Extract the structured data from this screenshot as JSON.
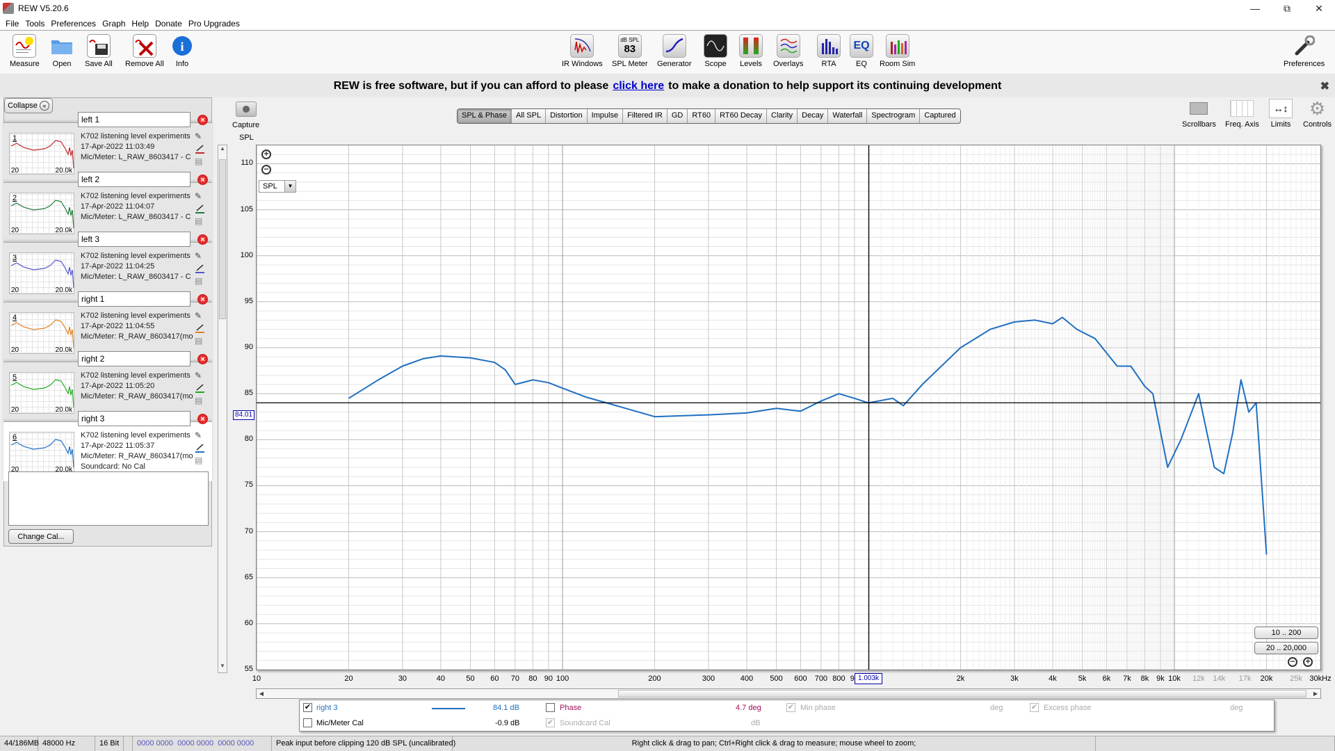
{
  "window": {
    "title": "REW V5.20.6",
    "controls": [
      "minimize",
      "restore",
      "close"
    ]
  },
  "menu": [
    "File",
    "Tools",
    "Preferences",
    "Graph",
    "Help",
    "Donate",
    "Pro Upgrades"
  ],
  "toolbar": {
    "left": [
      {
        "label": "Measure",
        "icon": "measure-icon"
      },
      {
        "label": "Open",
        "icon": "folder-icon"
      },
      {
        "label": "Save All",
        "icon": "save-icon"
      },
      {
        "label": "Remove All",
        "icon": "remove-all-icon"
      },
      {
        "label": "Info",
        "icon": "info-icon"
      }
    ],
    "center": [
      {
        "label": "IR Windows",
        "icon": "ir-windows-icon"
      },
      {
        "label": "SPL Meter",
        "icon": "spl-meter-icon",
        "badge_top": "dB SPL",
        "badge_value": "83"
      },
      {
        "label": "Generator",
        "icon": "sine-icon"
      },
      {
        "label": "Scope",
        "icon": "scope-icon"
      },
      {
        "label": "Levels",
        "icon": "levels-icon"
      },
      {
        "label": "Overlays",
        "icon": "overlays-icon"
      },
      {
        "label": "RTA",
        "icon": "rta-icon"
      },
      {
        "label": "EQ",
        "icon": "eq-icon"
      },
      {
        "label": "Room Sim",
        "icon": "room-sim-icon"
      }
    ],
    "right": {
      "label": "Preferences",
      "icon": "wrench-icon"
    }
  },
  "donate": {
    "before": "REW is free software, but if you can afford to please",
    "link": "click here",
    "after": "to make a donation to help support its continuing development"
  },
  "panel": {
    "collapse_label": "Collapse",
    "change_cal_label": "Change Cal...",
    "measurements": [
      {
        "num": "1",
        "name": "left 1",
        "title": "K702 listening level experiments",
        "date": "17-Apr-2022 11:03:49",
        "mic": "Mic/Meter: L_RAW_8603417 - C",
        "color": "#c0272d"
      },
      {
        "num": "2",
        "name": "left 2",
        "title": "K702 listening level experiments",
        "date": "17-Apr-2022 11:04:07",
        "mic": "Mic/Meter: L_RAW_8603417 - C",
        "color": "#1e7a3c"
      },
      {
        "num": "3",
        "name": "left 3",
        "title": "K702 listening level experiments",
        "date": "17-Apr-2022 11:04:25",
        "mic": "Mic/Meter: L_RAW_8603417 - C",
        "color": "#5555cc"
      },
      {
        "num": "4",
        "name": "right 1",
        "title": "K702 listening level experiments",
        "date": "17-Apr-2022 11:04:55",
        "mic": "Mic/Meter: R_RAW_8603417(mo",
        "color": "#e08020"
      },
      {
        "num": "5",
        "name": "right 2",
        "title": "K702 listening level experiments",
        "date": "17-Apr-2022 11:05:20",
        "mic": "Mic/Meter: R_RAW_8603417(mo",
        "color": "#22aa22"
      },
      {
        "num": "6",
        "name": "right 3",
        "title": "K702 listening level experiments",
        "date": "17-Apr-2022 11:05:37",
        "mic": "Mic/Meter: R_RAW_8603417(mo",
        "soundcard": "Soundcard: No Cal",
        "color": "#1f6fc0"
      }
    ],
    "thumb_left": "20",
    "thumb_right": "20.0k"
  },
  "graph": {
    "capture_label": "Capture",
    "tabs": [
      "SPL & Phase",
      "All SPL",
      "Distortion",
      "Impulse",
      "Filtered IR",
      "GD",
      "RT60",
      "RT60 Decay",
      "Clarity",
      "Decay",
      "Waterfall",
      "Spectrogram",
      "Captured"
    ],
    "active_tab": "SPL & Phase",
    "right_tools": [
      {
        "label": "Scrollbars",
        "icon": "scrollbars-icon"
      },
      {
        "label": "Freq. Axis",
        "icon": "freq-axis-icon"
      },
      {
        "label": "Limits",
        "icon": "limits-icon"
      },
      {
        "label": "Controls",
        "icon": "gear-icon"
      }
    ],
    "axis_type": "SPL",
    "y_cursor": "84.01",
    "x_cursor": "1.003k",
    "range_buttons": [
      "10 .. 200",
      "20 .. 20,000"
    ]
  },
  "chart_data": {
    "type": "line",
    "title": "",
    "xlabel": "Hz",
    "ylabel": "SPL",
    "xscale": "log",
    "xlim": [
      10,
      30000
    ],
    "ylim": [
      55,
      112
    ],
    "yticks": [
      55,
      60,
      65,
      70,
      75,
      80,
      85,
      90,
      95,
      100,
      105,
      110
    ],
    "xticks": [
      {
        "v": 10,
        "t": "10"
      },
      {
        "v": 20,
        "t": "20"
      },
      {
        "v": 30,
        "t": "30"
      },
      {
        "v": 40,
        "t": "40"
      },
      {
        "v": 50,
        "t": "50"
      },
      {
        "v": 60,
        "t": "60"
      },
      {
        "v": 70,
        "t": "70"
      },
      {
        "v": 80,
        "t": "80"
      },
      {
        "v": 90,
        "t": "90"
      },
      {
        "v": 100,
        "t": "100"
      },
      {
        "v": 200,
        "t": "200"
      },
      {
        "v": 300,
        "t": "300"
      },
      {
        "v": 400,
        "t": "400"
      },
      {
        "v": 500,
        "t": "500"
      },
      {
        "v": 600,
        "t": "600"
      },
      {
        "v": 700,
        "t": "700"
      },
      {
        "v": 800,
        "t": "800"
      },
      {
        "v": 900,
        "t": "90"
      },
      {
        "v": 2000,
        "t": "2k"
      },
      {
        "v": 3000,
        "t": "3k"
      },
      {
        "v": 4000,
        "t": "4k"
      },
      {
        "v": 5000,
        "t": "5k"
      },
      {
        "v": 6000,
        "t": "6k"
      },
      {
        "v": 7000,
        "t": "7k"
      },
      {
        "v": 8000,
        "t": "8k"
      },
      {
        "v": 9000,
        "t": "9k"
      },
      {
        "v": 10000,
        "t": "10k"
      },
      {
        "v": 12000,
        "t": "12k",
        "light": true
      },
      {
        "v": 14000,
        "t": "14k",
        "light": true
      },
      {
        "v": 17000,
        "t": "17k",
        "light": true
      },
      {
        "v": 20000,
        "t": "20k"
      },
      {
        "v": 25000,
        "t": "25k",
        "light": true
      },
      {
        "v": 30000,
        "t": "30kHz"
      }
    ],
    "cursor": {
      "x": 1003,
      "y": 84.01
    },
    "series": [
      {
        "name": "right 3",
        "color": "#1f6fc0",
        "x": [
          20,
          25,
          30,
          35,
          40,
          50,
          60,
          65,
          70,
          80,
          90,
          100,
          120,
          150,
          200,
          300,
          400,
          500,
          600,
          700,
          800,
          900,
          1000,
          1200,
          1300,
          1500,
          2000,
          2500,
          3000,
          3500,
          4000,
          4300,
          4800,
          5500,
          6500,
          7200,
          8000,
          8500,
          9500,
          10500,
          12000,
          13500,
          14500,
          15500,
          16500,
          17500,
          18500,
          20000
        ],
        "y": [
          84.5,
          86.5,
          88,
          88.8,
          89.1,
          88.9,
          88.4,
          87.6,
          86,
          86.5,
          86.2,
          85.6,
          84.6,
          83.7,
          82.5,
          82.7,
          82.9,
          83.4,
          83.1,
          84.2,
          85,
          84.5,
          84,
          84.5,
          83.7,
          86,
          90,
          92,
          92.8,
          93,
          92.6,
          93.3,
          92,
          91,
          88,
          88,
          85.8,
          85,
          77,
          80,
          85,
          77,
          76.3,
          80.7,
          86.5,
          83,
          84,
          67.5
        ]
      }
    ]
  },
  "legend": {
    "rows": [
      {
        "checked": true,
        "label": "right 3",
        "value": "84.1 dB"
      },
      {
        "checked": false,
        "label": "Mic/Meter Cal",
        "value": "-0.9 dB"
      }
    ],
    "phase": {
      "checked": false,
      "label": "Phase",
      "value": "4.7 deg"
    },
    "soundcard_cal": {
      "checked": true,
      "label": "Soundcard Cal",
      "unit": "dB"
    },
    "min_phase": {
      "checked": true,
      "label": "Min phase",
      "unit": "deg"
    },
    "excess_phase": {
      "checked": true,
      "label": "Excess phase",
      "unit": "deg"
    }
  },
  "status": {
    "memory": "44/186MB",
    "rate": "48000 Hz",
    "bits": "16 Bit",
    "levels": "0000 0000  0000 0000  0000 0000",
    "peak": "Peak input before clipping 120 dB SPL (uncalibrated)",
    "hint": "Right click & drag to pan; Ctrl+Right click & drag to measure; mouse wheel to zoom;"
  }
}
